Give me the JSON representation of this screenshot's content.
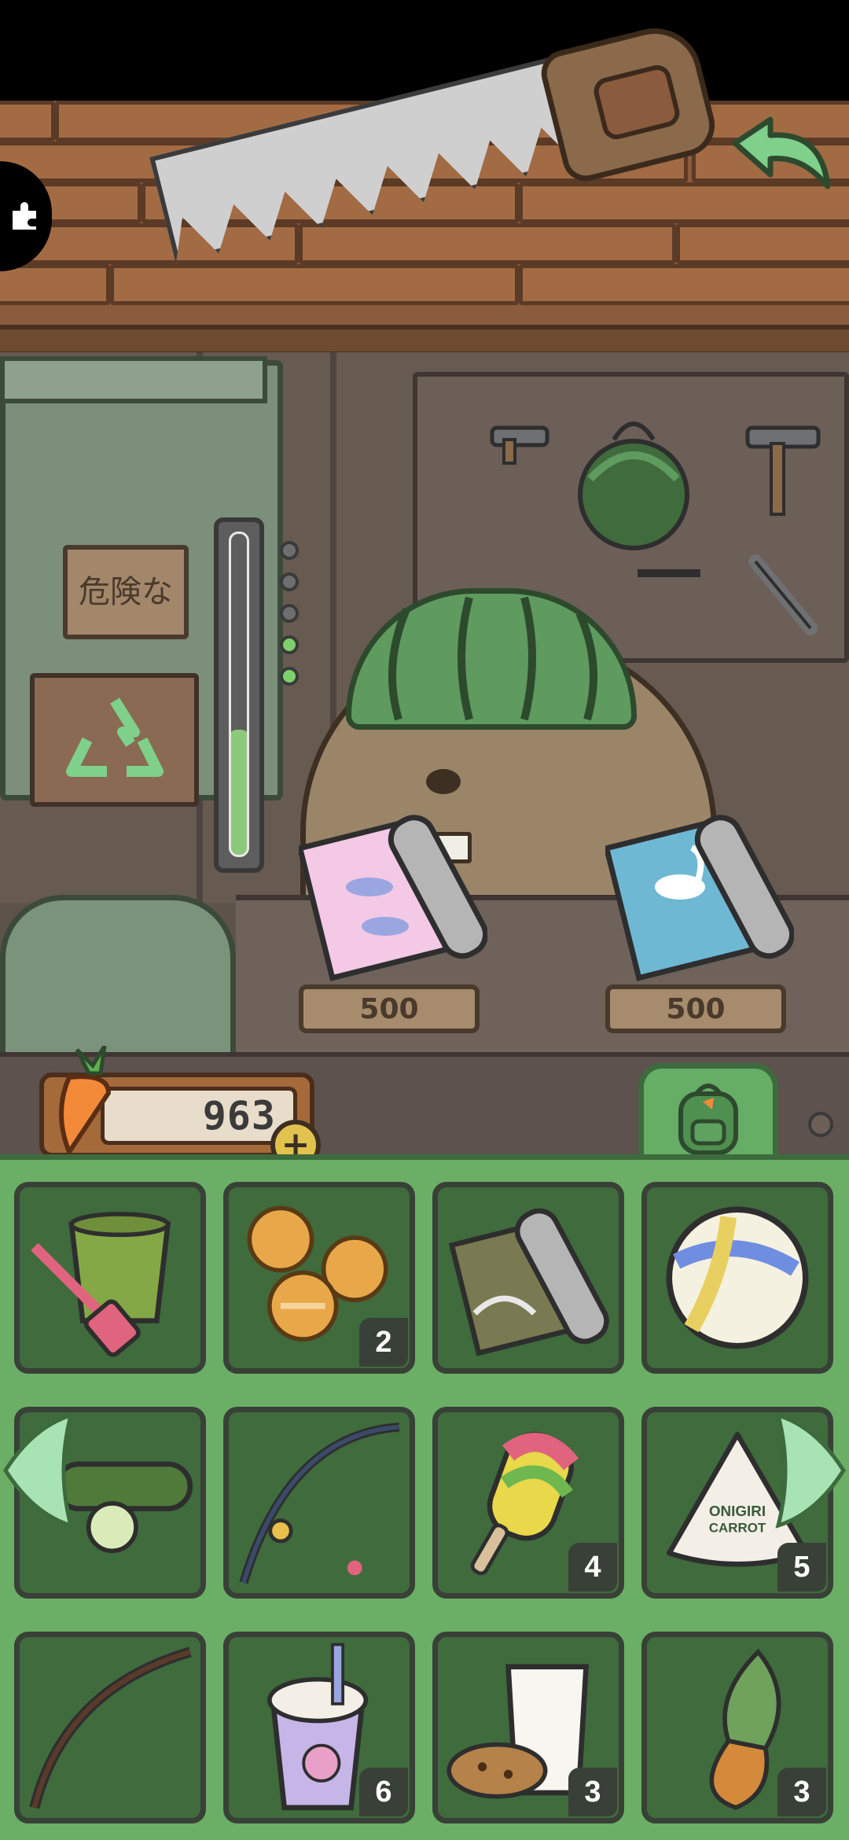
{
  "colors": {
    "inventory_bg": "#6aaf65",
    "slot_bg": "#3f6b3d",
    "accent_back_arrow": "#7ed08a",
    "currency_add": "#e2c24e"
  },
  "header": {
    "puzzle_icon": "puzzle-icon",
    "back_icon": "back-arrow-icon"
  },
  "scene": {
    "danger_sign_text": "危険な",
    "gauge_lights_on": 2,
    "gauge_lights_total": 5
  },
  "shop": {
    "items": [
      {
        "name": "shark-pattern-wallpaper",
        "price": "500"
      },
      {
        "name": "swan-pattern-wallpaper",
        "price": "500"
      }
    ]
  },
  "currency": {
    "icon": "carrot-icon",
    "amount": "963",
    "add_label": "+"
  },
  "inventory": {
    "tab_icon": "backpack-icon",
    "slots": [
      {
        "item": "sand-bucket-and-shovel",
        "count": ""
      },
      {
        "item": "animal-cookies",
        "count": "2"
      },
      {
        "item": "wave-pattern-wallpaper",
        "count": ""
      },
      {
        "item": "volleyball",
        "count": ""
      },
      {
        "item": "cucumber",
        "count": ""
      },
      {
        "item": "fishing-rod",
        "count": ""
      },
      {
        "item": "popsicle",
        "count": "4"
      },
      {
        "item": "onigiri-carrot",
        "count": "5",
        "label": "ONIGIRI CARROT"
      },
      {
        "item": "bow",
        "count": ""
      },
      {
        "item": "bubble-tea",
        "count": "6"
      },
      {
        "item": "milk-and-cookies",
        "count": "3"
      },
      {
        "item": "taiyaki-ice-cream",
        "count": "3"
      }
    ]
  }
}
